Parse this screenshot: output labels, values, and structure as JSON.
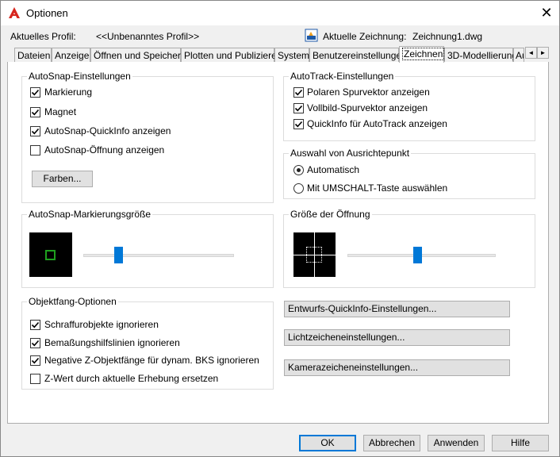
{
  "window": {
    "title": "Optionen",
    "close_glyph": "✕"
  },
  "header": {
    "profile_label": "Aktuelles Profil:",
    "profile_value": "<<Unbenanntes Profil>>",
    "drawing_label": "Aktuelle Zeichnung:",
    "drawing_value": "Zeichnung1.dwg"
  },
  "tabs": [
    {
      "label": "Dateien"
    },
    {
      "label": "Anzeige"
    },
    {
      "label": "Öffnen und Speichern"
    },
    {
      "label": "Plotten und Publizieren"
    },
    {
      "label": "System"
    },
    {
      "label": "Benutzereinstellungen"
    },
    {
      "label": "Zeichnen",
      "active": true
    },
    {
      "label": "3D-Modellierung"
    },
    {
      "label": "Au"
    }
  ],
  "tab_scroll": {
    "left_glyph": "◄",
    "right_glyph": "►"
  },
  "autosnap": {
    "title": "AutoSnap-Einstellungen",
    "items": [
      {
        "label": "Markierung",
        "checked": true
      },
      {
        "label": "Magnet",
        "checked": true
      },
      {
        "label": "AutoSnap-QuickInfo anzeigen",
        "checked": true
      },
      {
        "label": "AutoSnap-Öffnung anzeigen",
        "checked": false
      }
    ],
    "colors_button": "Farben..."
  },
  "autotrack": {
    "title": "AutoTrack-Einstellungen",
    "items": [
      {
        "label": "Polaren Spurvektor anzeigen",
        "checked": true
      },
      {
        "label": "Vollbild-Spurvektor anzeigen",
        "checked": true
      },
      {
        "label": "QuickInfo für AutoTrack anzeigen",
        "checked": true
      }
    ]
  },
  "alignment": {
    "title": "Auswahl von Ausrichtepunkt",
    "options": [
      {
        "label": "Automatisch",
        "selected": true
      },
      {
        "label": "Mit UMSCHALT-Taste auswählen",
        "selected": false
      }
    ]
  },
  "marker_size": {
    "title": "AutoSnap-Markierungsgröße",
    "marker_color": "#1fa01f",
    "slider_fraction": 0.22
  },
  "aperture_size": {
    "title": "Größe der Öffnung",
    "slider_fraction": 0.47
  },
  "osnap": {
    "title": "Objektfang-Optionen",
    "items": [
      {
        "label": "Schraffurobjekte ignorieren",
        "checked": true
      },
      {
        "label": "Bemaßungshilfslinien ignorieren",
        "checked": true
      },
      {
        "label": "Negative Z-Objektfänge für dynam. BKS ignorieren",
        "checked": true
      },
      {
        "label": "Z-Wert durch aktuelle Erhebung ersetzen",
        "checked": false
      }
    ]
  },
  "right_buttons": {
    "draft_tooltip": "Entwurfs-QuickInfo-Einstellungen...",
    "lights_glyph": "Lichtzeicheneinstellungen...",
    "camera_glyph": "Kamerazeicheneinstellungen..."
  },
  "footer": {
    "ok": "OK",
    "cancel": "Abbrechen",
    "apply": "Anwenden",
    "help": "Hilfe"
  },
  "colors": {
    "accent": "#0078d7",
    "title_icon_red": "#d7261e",
    "drawing_icon_blue": "#1e5aa8"
  }
}
